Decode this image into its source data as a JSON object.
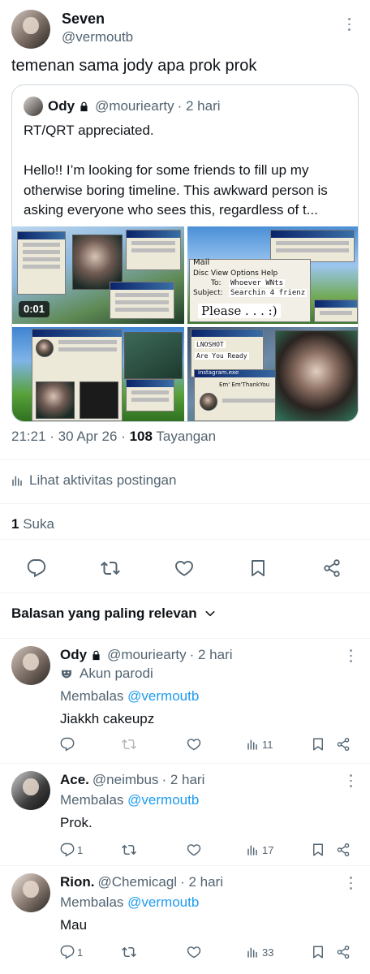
{
  "post": {
    "author_name": "Seven",
    "author_handle": "@vermoutb",
    "text": "temenan sama jody apa prok prok",
    "quote": {
      "name": "Ody",
      "handle": "@mouriearty",
      "time": "· 2 hari",
      "line1": "RT/QRT appreciated.",
      "line2": "Hello!! I’m looking for some friends to fill up my otherwise boring timeline. This awkward person is asking everyone who sees this, regardless of t...",
      "media": {
        "video_duration": "0:01",
        "tile2_mail_title": "Mail",
        "tile2_menu": "Disc View Options Help",
        "tile2_to": "To:",
        "tile2_to_value": "Whoever WNts",
        "tile2_subject": "Subject:",
        "tile2_subject_value": "Searchin 4 frienz",
        "tile2_please": "Please . . . :)",
        "tile4_field1": "LNOSHOT",
        "tile4_field2": "Are You Ready",
        "tile4_window": "instagram.exe",
        "tile4_caption": "Em' Em'ThankYou"
      }
    },
    "time": "21:21 · 30 Apr 26 ·",
    "views_count": "108",
    "views_label": "Tayangan",
    "activity_label": "Lihat aktivitas postingan",
    "likes_count": "1",
    "likes_label": "Suka"
  },
  "sort_label": "Balasan yang paling relevan",
  "replies": [
    {
      "name": "Ody",
      "handle": "@mouriearty",
      "time": "· 2 hari",
      "parody_label": "Akun parodi",
      "replying_prefix": "Membalas",
      "replying_to": "@vermoutb",
      "text": "Jiakkh cakeupz",
      "replies": "",
      "views": "11"
    },
    {
      "name": "Ace.",
      "handle": "@neimbus",
      "time": "· 2 hari",
      "replying_prefix": "Membalas",
      "replying_to": "@vermoutb",
      "text": "Prok.",
      "replies": "1",
      "views": "17"
    },
    {
      "name": "Rion.",
      "handle": "@Chemicagl",
      "time": "· 2 hari",
      "replying_prefix": "Membalas",
      "replying_to": "@vermoutb",
      "text": "Mau",
      "replies": "1",
      "views": "33"
    }
  ]
}
